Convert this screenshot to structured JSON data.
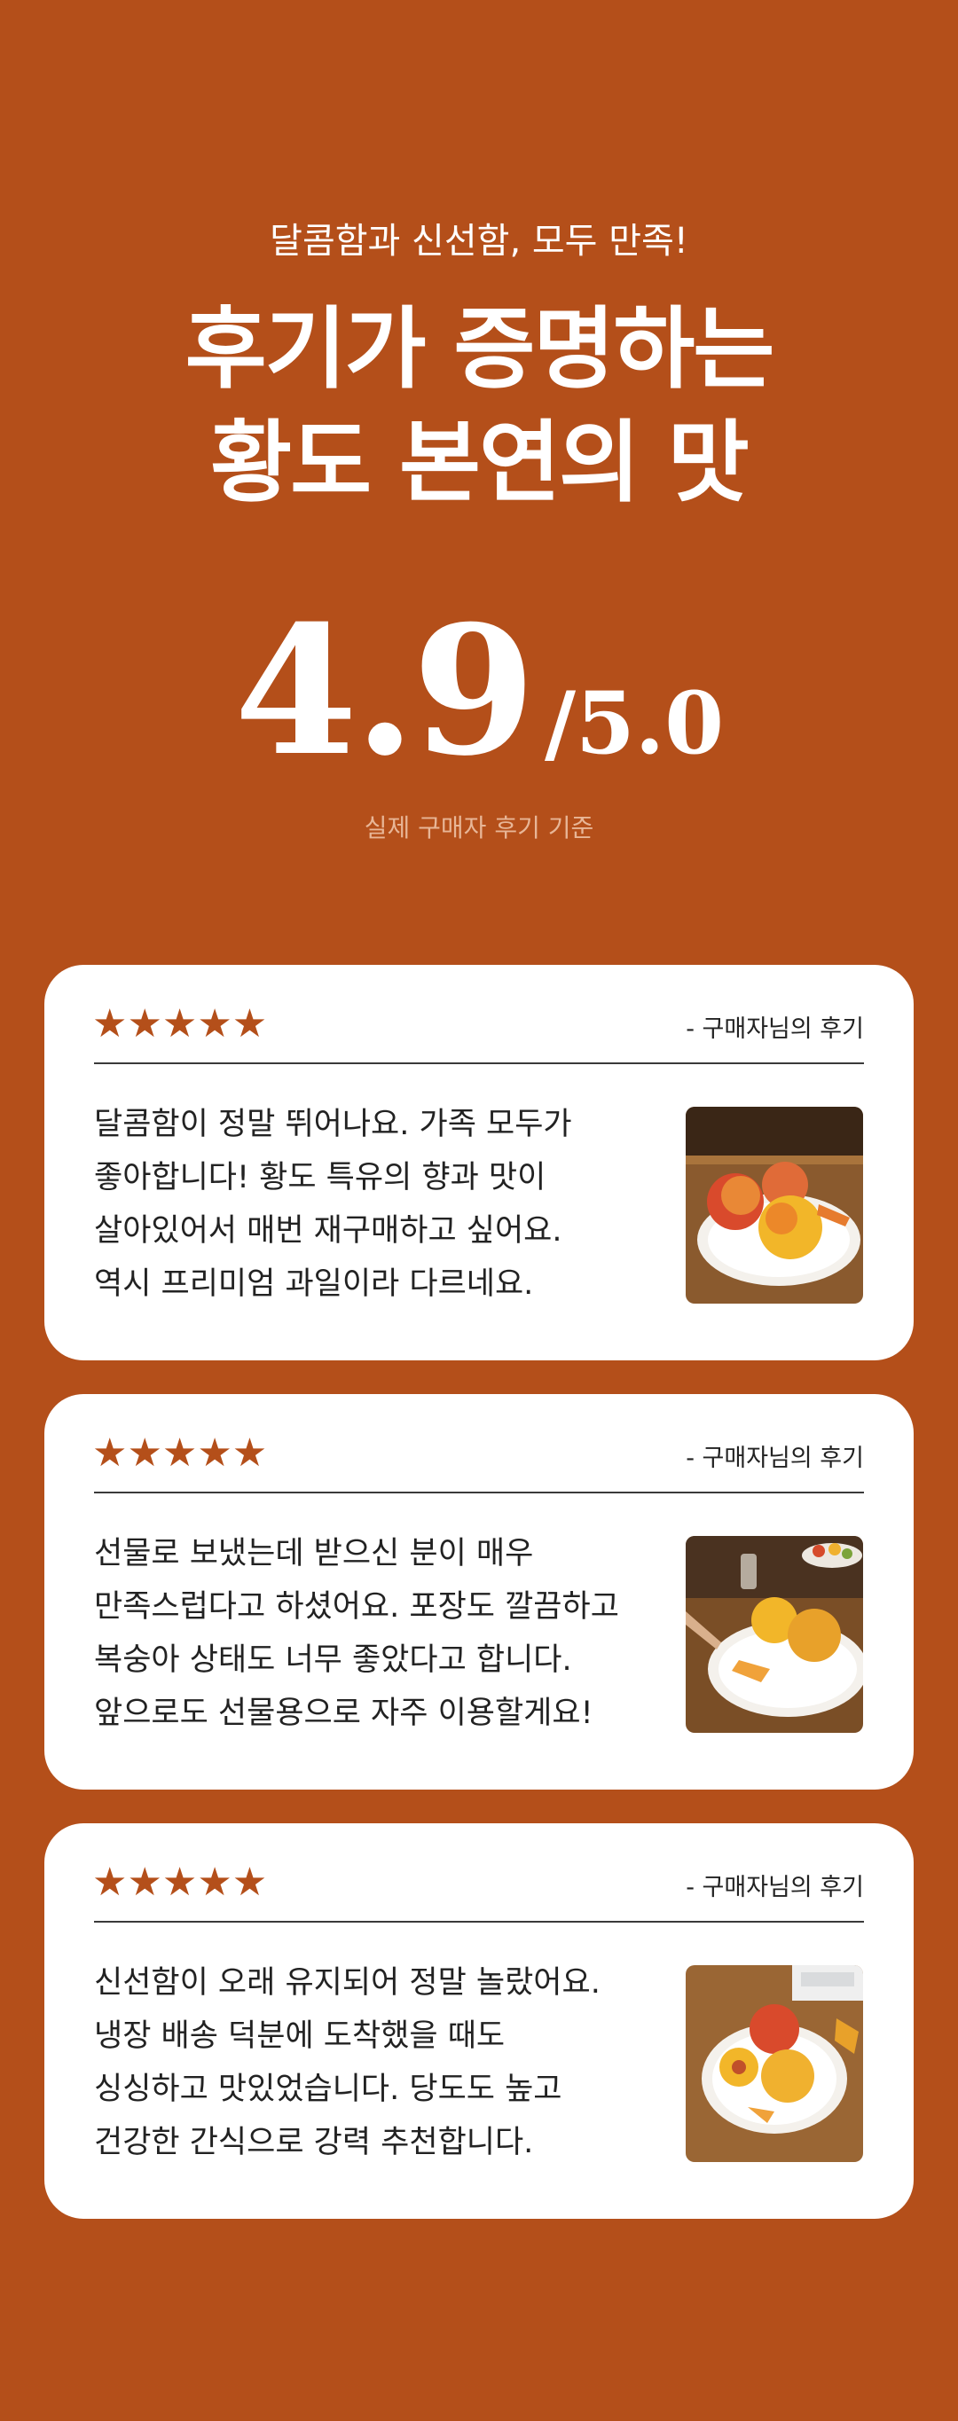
{
  "hero": {
    "subtitle": "달콤함과 신선함, 모두 만족!",
    "headline_line1": "후기가 증명하는",
    "headline_line2": "황도 본연의 맛"
  },
  "rating": {
    "score": "4.9",
    "out_of": "/5.0",
    "stars_value": 4.9,
    "note": "실제 구매자 후기 기준"
  },
  "colors": {
    "background": "#B44F1A",
    "card": "#FFFFFF",
    "star": "#B44F1A"
  },
  "reviews": [
    {
      "stars": "★★★★★",
      "rating": 5,
      "author": "- 구매자님의 후기",
      "lines": [
        "달콤함이 정말 뛰어나요. 가족 모두가",
        "좋아합니다! 황도 특유의 향과 맛이",
        "살아있어서 매번 재구매하고 싶어요.",
        "역시 프리미엄 과일이라 다르네요."
      ],
      "photo_icon": "peach-plate-photo"
    },
    {
      "stars": "★★★★★",
      "rating": 5,
      "author": "- 구매자님의 후기",
      "lines": [
        "선물로 보냈는데 받으신 분이 매우",
        "만족스럽다고 하셨어요. 포장도 깔끔하고",
        "복숭아 상태도 너무 좋았다고 합니다.",
        "앞으로도 선물용으로 자주 이용할게요!"
      ],
      "photo_icon": "peach-plate-photo"
    },
    {
      "stars": "★★★★★",
      "rating": 5,
      "author": "- 구매자님의 후기",
      "lines": [
        "신선함이 오래 유지되어 정말 놀랐어요.",
        "냉장 배송 덕분에 도착했을 때도",
        "싱싱하고 맛있었습니다. 당도도 높고",
        "건강한 간식으로 강력 추천합니다."
      ],
      "photo_icon": "peach-plate-photo"
    }
  ]
}
